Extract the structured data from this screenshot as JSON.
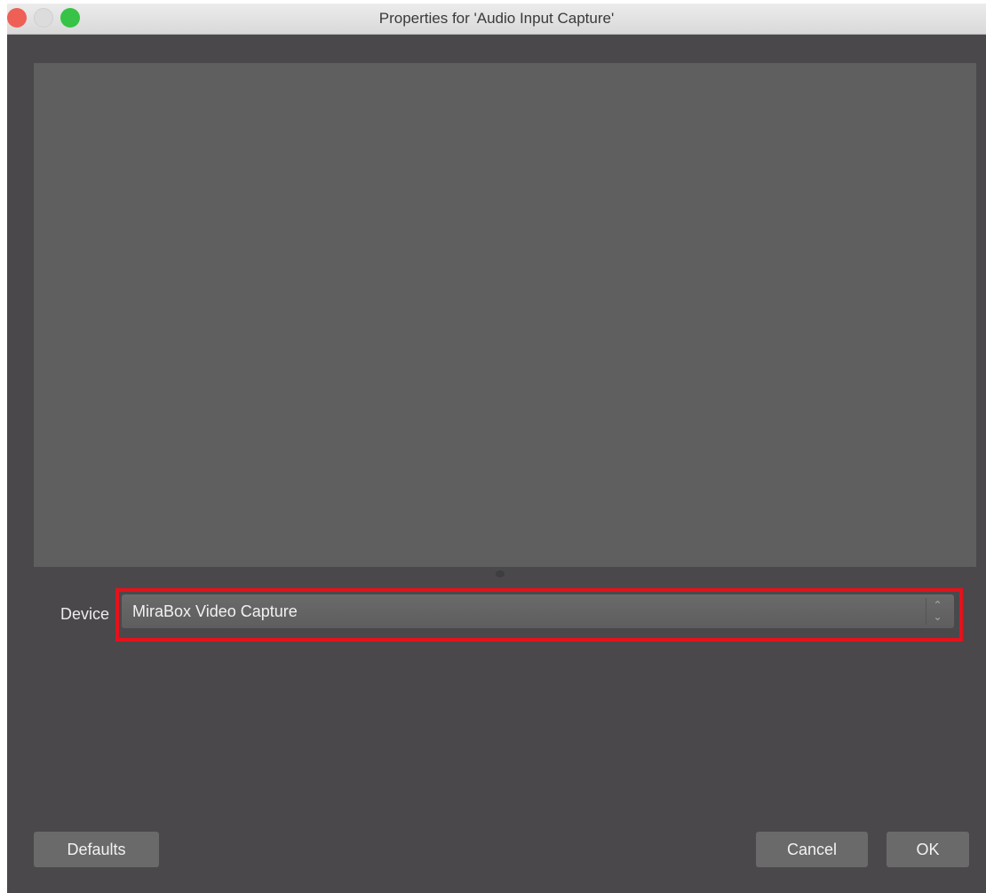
{
  "window": {
    "title": "Properties for 'Audio Input Capture'"
  },
  "traffic_lights": {
    "close_color": "#ee5f56",
    "minimize_color": "#dcdcdc",
    "maximize_color": "#37c345"
  },
  "properties": {
    "device_label": "Device",
    "device_value": "MiraBox Video Capture",
    "highlight_color": "#e4121b"
  },
  "buttons": {
    "defaults": "Defaults",
    "cancel": "Cancel",
    "ok": "OK"
  }
}
